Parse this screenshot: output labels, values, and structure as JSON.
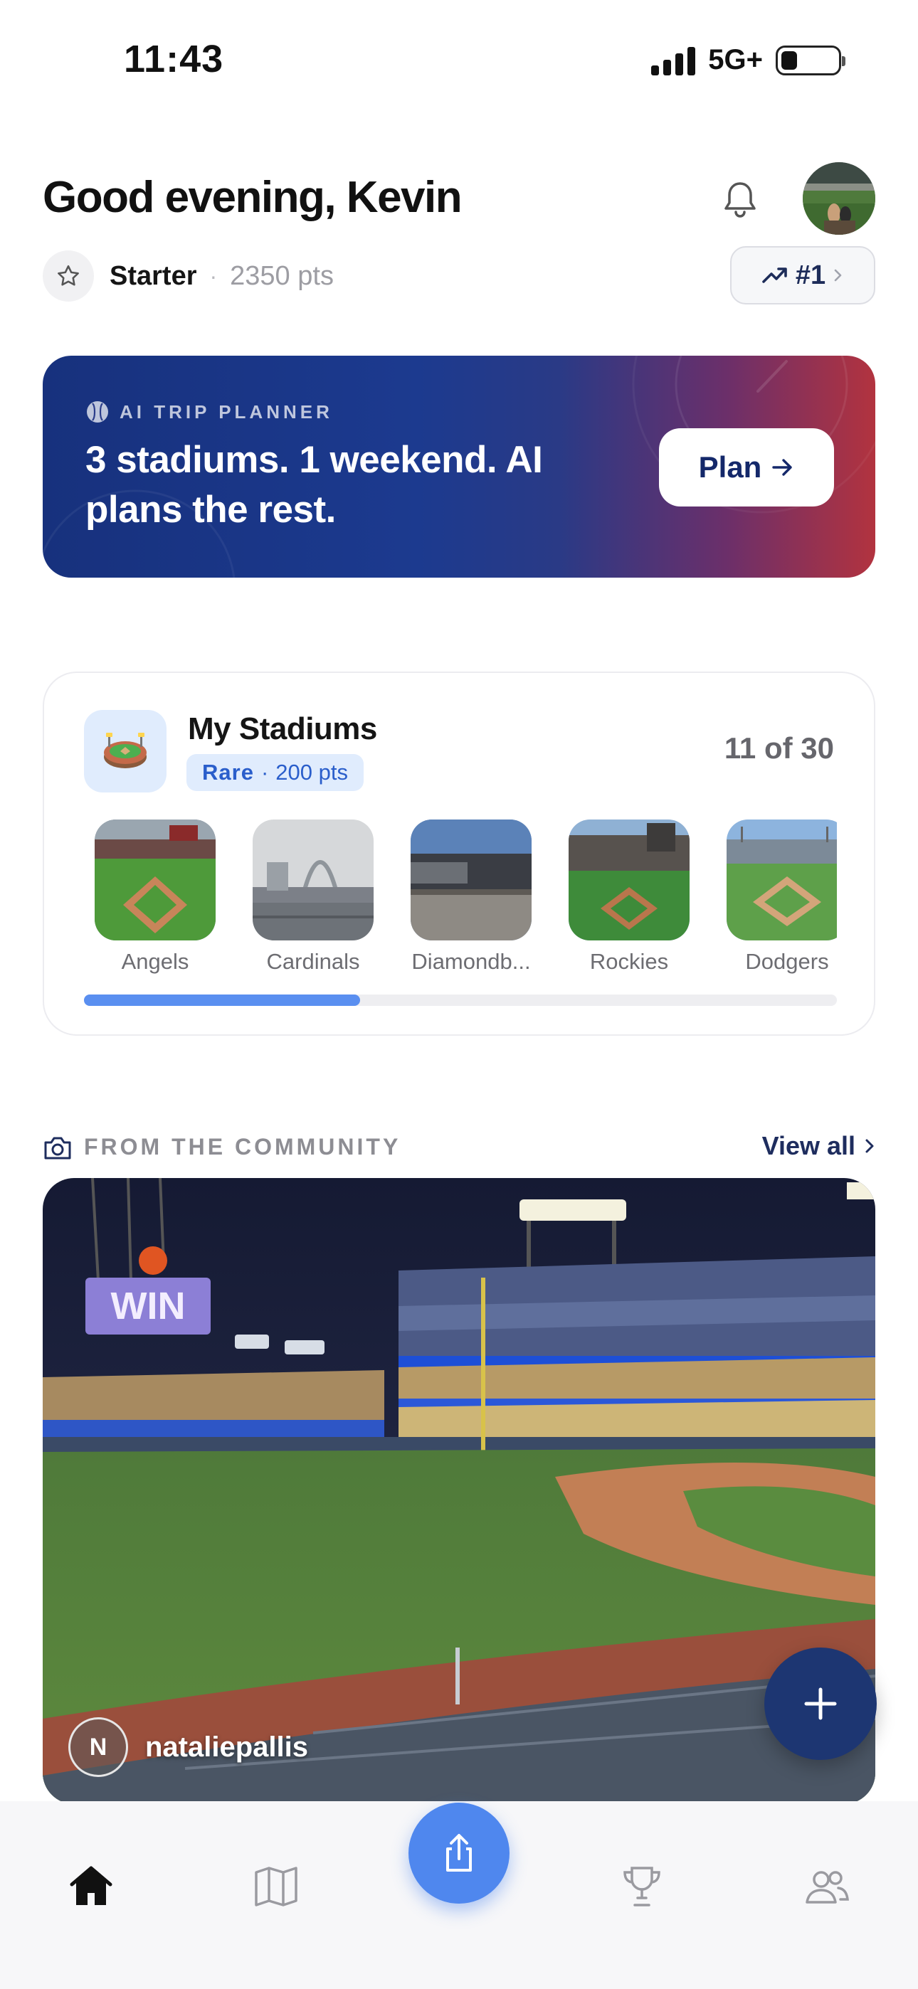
{
  "status_bar": {
    "time": "11:43",
    "network": "5G+"
  },
  "header": {
    "greeting": "Good evening, Kevin",
    "tier": "Starter",
    "separator": "·",
    "points": "2350 pts",
    "rank": "#1"
  },
  "banner": {
    "kicker": "AI TRIP PLANNER",
    "title": "3 stadiums. 1 weekend. AI plans the rest.",
    "button_label": "Plan"
  },
  "stadiums": {
    "title": "My Stadiums",
    "rarity": "Rare",
    "separator": "·",
    "rarity_points": "200 pts",
    "count": "11 of 30",
    "progress": 0.367,
    "items": [
      {
        "label": "Angels"
      },
      {
        "label": "Cardinals"
      },
      {
        "label": "Diamondb..."
      },
      {
        "label": "Rockies"
      },
      {
        "label": "Dodgers"
      }
    ]
  },
  "community": {
    "title": "FROM THE COMMUNITY",
    "view_all": "View all",
    "post": {
      "initial": "N",
      "username": "nataliepallis"
    }
  },
  "colors": {
    "accent_blue": "#4f87ee",
    "navy": "#1d3672",
    "banner_start": "#17317d",
    "banner_end": "#b2333f",
    "badge_bg": "#e0ecfd"
  },
  "icons": {
    "bell": "bell-icon",
    "star": "star-icon",
    "trend": "trending-up-icon",
    "baseball": "baseball-icon",
    "camera": "camera-icon",
    "home": "home-icon",
    "map": "map-icon",
    "share": "share-icon",
    "trophy": "trophy-icon",
    "friends": "users-icon",
    "add": "plus-icon"
  }
}
